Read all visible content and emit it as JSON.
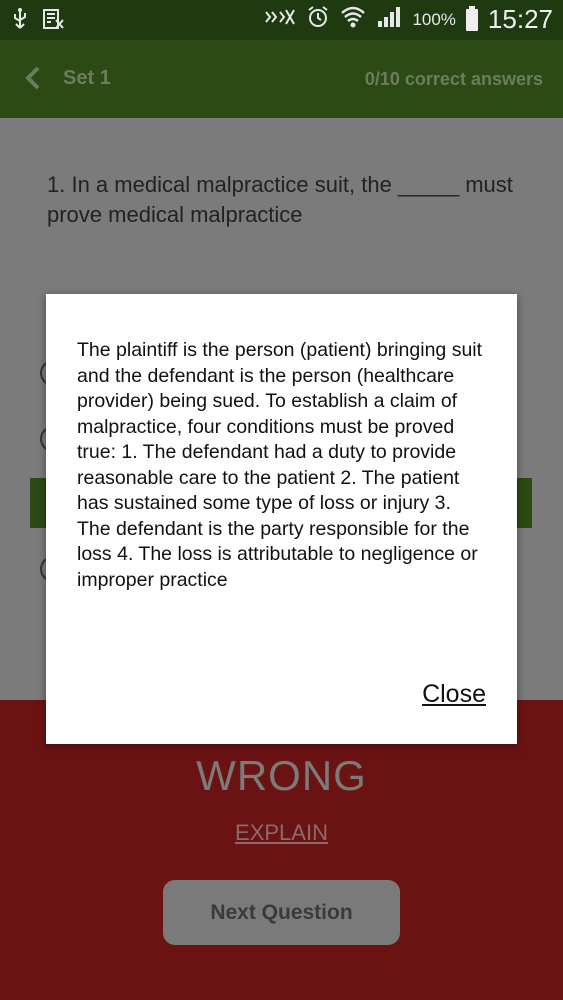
{
  "status_bar": {
    "battery_text": "100%",
    "time": "15:27"
  },
  "app_bar": {
    "title": "Set 1",
    "score": "0/10 correct answers"
  },
  "question": {
    "text": "1. In a medical malpractice suit, the _____ must prove medical malpractice"
  },
  "result": {
    "verdict": "WRONG",
    "explain_label": "EXPLAIN",
    "next_label": "Next Question"
  },
  "dialog": {
    "text": "The plaintiff is the person (patient) bringing suit and the defendant is the person (healthcare provider) being sued. To establish a claim of malpractice, four conditions must be proved true: 1. The defendant had a duty to provide reasonable care to the patient 2. The patient has sustained some type of loss or injury 3. The defendant is the party responsible for the loss 4. The loss is attributable to negligence or improper practice",
    "close_label": "Close"
  },
  "colors": {
    "app_bar": "#2b4a14",
    "result_bg": "#6b1313",
    "dim_bg": "#7b7b7b"
  }
}
